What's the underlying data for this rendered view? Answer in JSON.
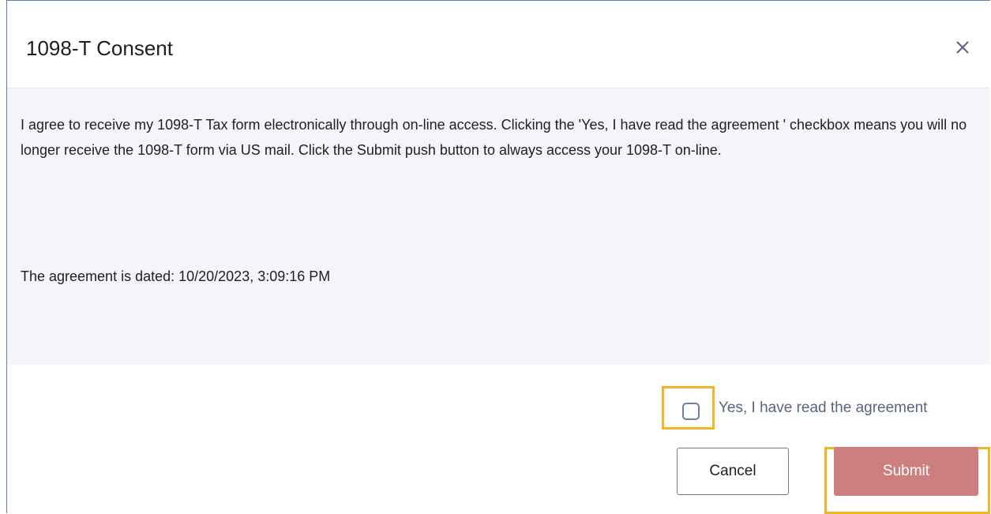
{
  "dialog": {
    "title": "1098-T Consent",
    "close_icon": "close-icon",
    "body_text": "I agree to receive my 1098-T Tax form electronically through on-line access. Clicking the 'Yes, I have read the agreement ' checkbox means you will no longer receive the 1098-T form via US mail. Click the Submit push button to always access your 1098-T on-line.",
    "date_line": "The agreement is dated: 10/20/2023, 3:09:16 PM",
    "checkbox_label": "Yes, I have read the agreement",
    "checkbox_checked": false,
    "cancel_label": "Cancel",
    "submit_label": "Submit"
  },
  "colors": {
    "body_background": "#f3f5f8",
    "submit_background": "#cd7f7f",
    "highlight_border": "#f0b429",
    "checkbox_border": "#6f7fa8"
  }
}
